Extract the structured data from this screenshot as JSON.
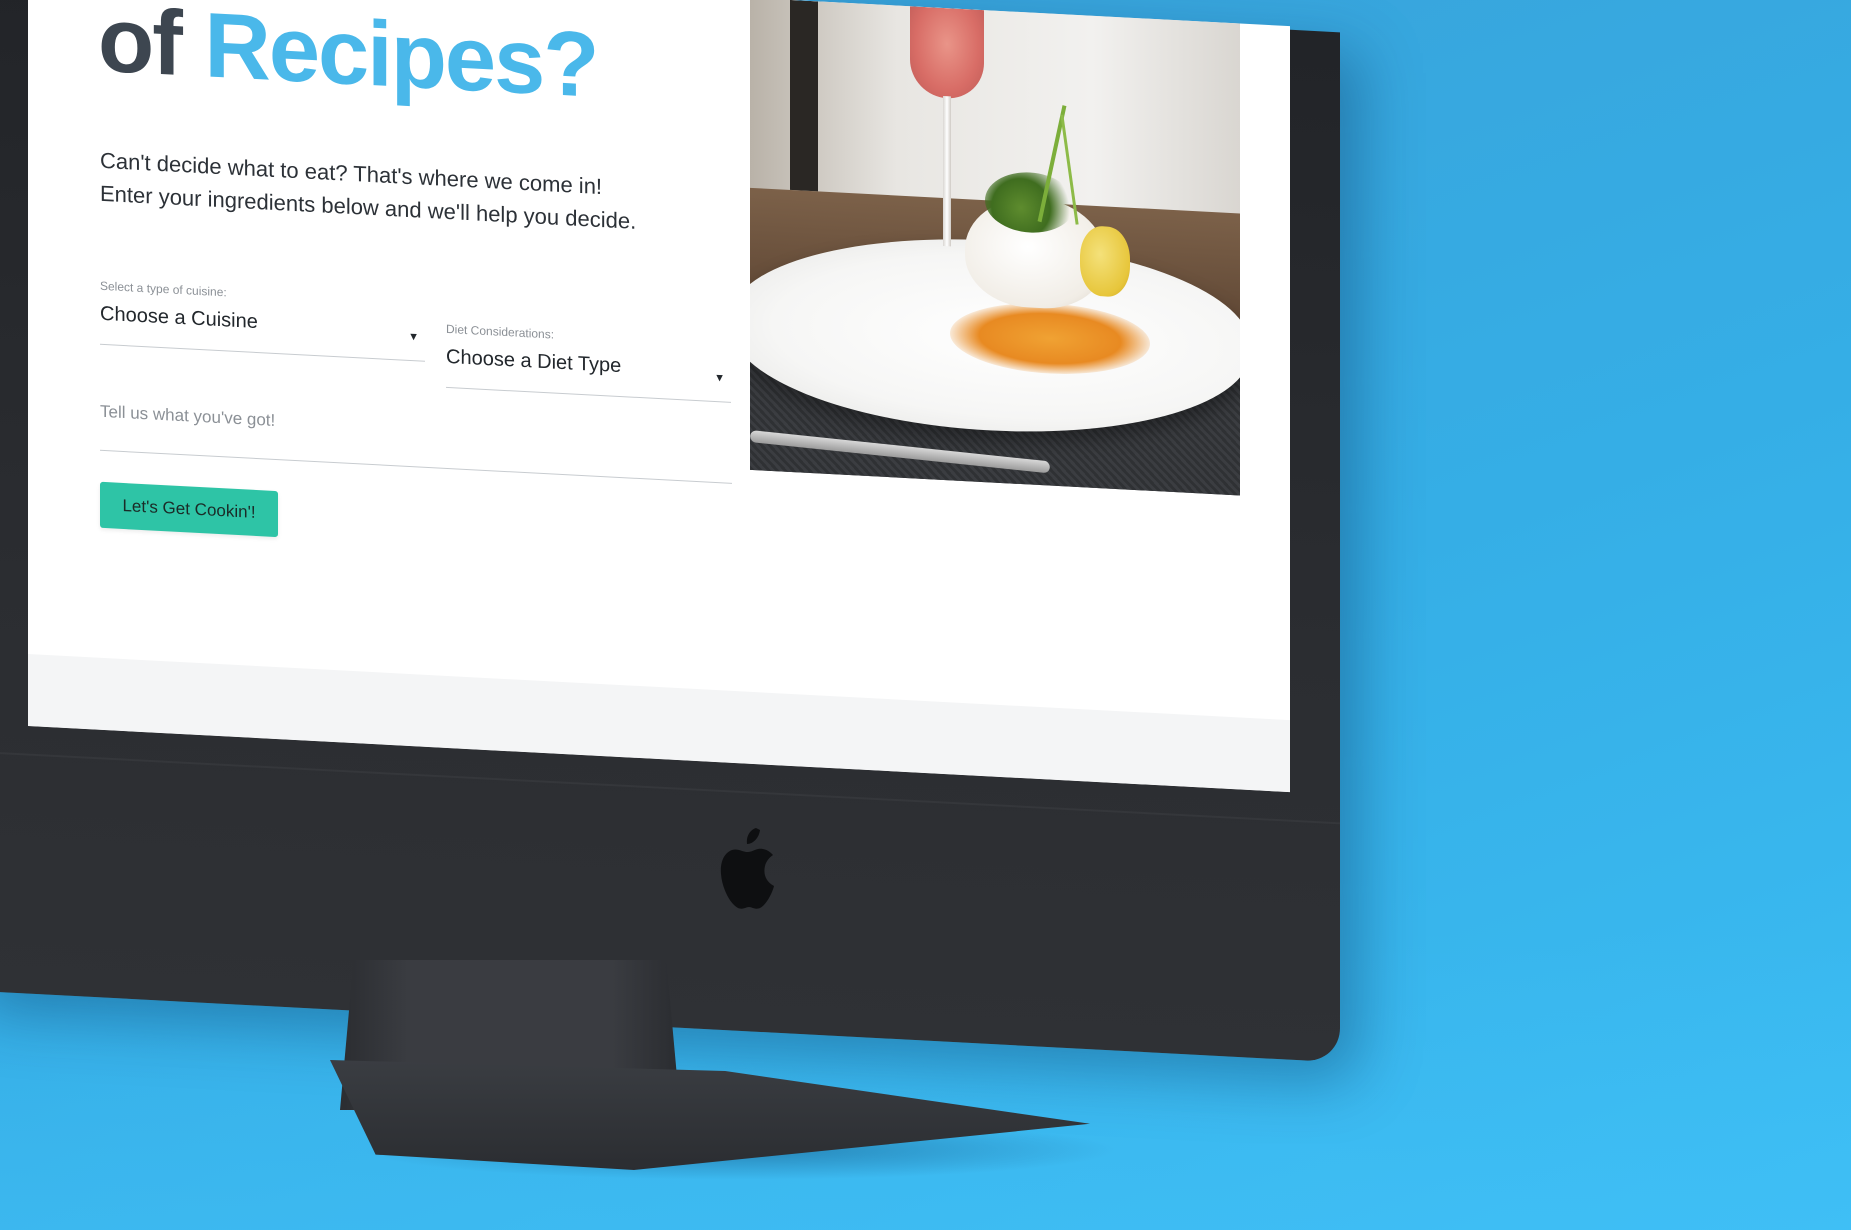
{
  "hero": {
    "title_prefix": "of",
    "title_highlight": "Recipes?",
    "subtitle_line1": "Can't decide what to eat? That's where we come in!",
    "subtitle_line2": "Enter your ingredients below and we'll help you decide."
  },
  "form": {
    "cuisine_label": "Select a type of cuisine:",
    "cuisine_value": "Choose a Cuisine",
    "diet_label": "Diet Considerations:",
    "diet_value": "Choose a Diet Type",
    "ingredients_placeholder": "Tell us what you've got!",
    "submit_label": "Let's Get Cookin'!"
  },
  "colors": {
    "background": "#3aaee6",
    "title_dark": "#3d4650",
    "title_accent": "#4ab8ea",
    "button": "#2ec4a6",
    "device": "#2b2d31"
  },
  "icons": {
    "dropdown": "caret-down-icon",
    "device_logo": "apple-logo-icon"
  }
}
